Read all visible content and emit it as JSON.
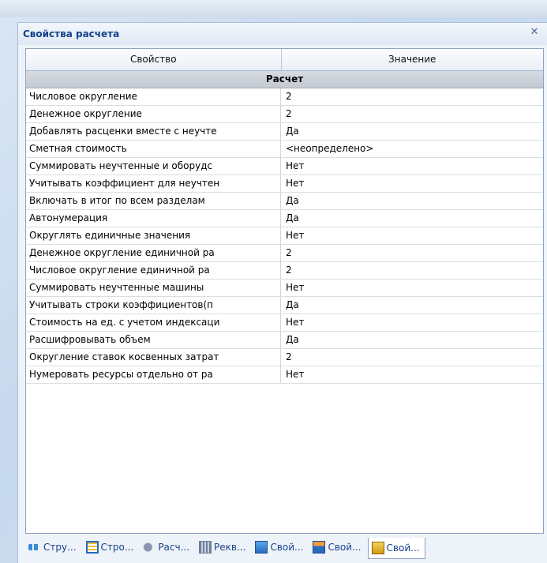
{
  "window": {
    "title": "Свойства расчета"
  },
  "grid": {
    "columns": [
      "Свойство",
      "Значение"
    ],
    "category": "Расчет",
    "rows": [
      {
        "name": "Числовое округление",
        "value": "2"
      },
      {
        "name": "Денежное округление",
        "value": "2"
      },
      {
        "name": "Добавлять расценки вместе с неучте",
        "value": "Да"
      },
      {
        "name": "Сметная стоимость",
        "value": "<неопределено>"
      },
      {
        "name": "Суммировать неучтенные и оборудс",
        "value": "Нет"
      },
      {
        "name": "Учитывать коэффициент для неучтен",
        "value": "Нет"
      },
      {
        "name": "Включать в итог по всем разделам",
        "value": "Да"
      },
      {
        "name": "Автонумерация",
        "value": "Да"
      },
      {
        "name": "Округлять единичные значения",
        "value": "Нет"
      },
      {
        "name": "Денежное округление единичной ра",
        "value": "2"
      },
      {
        "name": "Числовое округление единичной ра",
        "value": "2"
      },
      {
        "name": "Суммировать неучтенные машины",
        "value": "Нет"
      },
      {
        "name": "Учитывать строки коэффициентов(п",
        "value": "Да"
      },
      {
        "name": "Стоимость на ед. с учетом индексаци",
        "value": "Нет"
      },
      {
        "name": "Расшифровывать объем",
        "value": "Да"
      },
      {
        "name": "Округление ставок косвенных затрат",
        "value": "2"
      },
      {
        "name": "Нумеровать ресурсы отдельно от ра",
        "value": "Нет"
      }
    ]
  },
  "tabs": [
    {
      "label": "Стру...",
      "icon": "structure-icon"
    },
    {
      "label": "Стро...",
      "icon": "lines-icon"
    },
    {
      "label": "Расч...",
      "icon": "calc-icon"
    },
    {
      "label": "Рекв...",
      "icon": "requisites-icon"
    },
    {
      "label": "Свой...",
      "icon": "properties-icon"
    },
    {
      "label": "Свой...",
      "icon": "properties-icon"
    },
    {
      "label": "Свой...",
      "icon": "properties-icon"
    }
  ]
}
